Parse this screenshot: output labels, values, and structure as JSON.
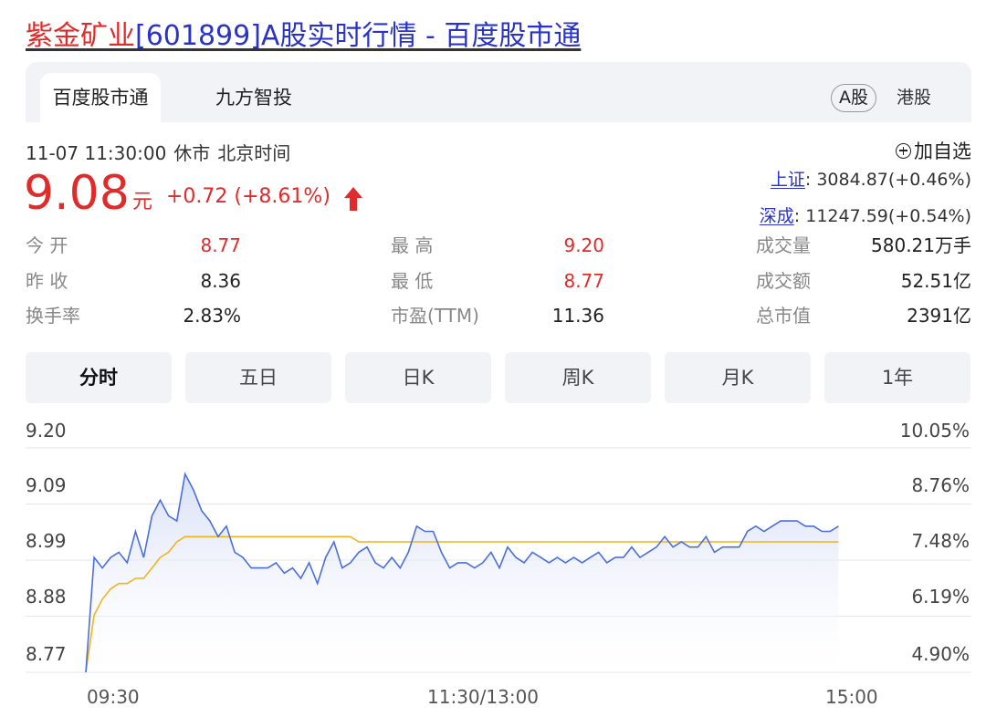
{
  "page": {
    "title_stock": "紫金矿业",
    "title_rest": "[601899]A股实时行情 - 百度股市通"
  },
  "tabs": {
    "active": "百度股市通",
    "second": "九方智投"
  },
  "markets": {
    "a_share": "A股",
    "hk_share": "港股"
  },
  "status": {
    "datetime": "11-07 11:30:00",
    "state": "休市",
    "timezone": "北京时间"
  },
  "add_watchlist": "加自选",
  "indices": [
    {
      "name": "上证",
      "value": ": 3084.87(+0.46%)"
    },
    {
      "name": "深成",
      "value": ": 11247.59(+0.54%)"
    }
  ],
  "price": {
    "value": "9.08",
    "unit": "元",
    "change": "+0.72 (+8.61%)",
    "color": "#e02b2b"
  },
  "quote": {
    "open_label": "今 开",
    "open": "8.77",
    "prev_close_label": "昨 收",
    "prev_close": "8.36",
    "turnover_rate_label": "换手率",
    "turnover_rate": "2.83%",
    "high_label": "最 高",
    "high": "9.20",
    "low_label": "最 低",
    "low": "8.77",
    "pe_label": "市盈(TTM)",
    "pe": "11.36",
    "volume_label": "成交量",
    "volume": "580.21万手",
    "amount_label": "成交额",
    "amount": "52.51亿",
    "mcap_label": "总市值",
    "mcap": "2391亿"
  },
  "periods": [
    "分时",
    "五日",
    "日K",
    "周K",
    "月K",
    "1年"
  ],
  "chart_data": {
    "type": "line",
    "y_ticks": [
      "9.20",
      "9.09",
      "8.99",
      "8.88",
      "8.77"
    ],
    "y_right_ticks": [
      "10.05%",
      "8.76%",
      "7.48%",
      "6.19%",
      "4.90%"
    ],
    "x_ticks": [
      "09:30",
      "11:30/13:00",
      "15:00"
    ],
    "ylim": [
      8.77,
      9.2
    ],
    "grid": true,
    "colors": {
      "price": "#4a6fdc",
      "avg": "#f2b31d",
      "fill": "#dde3f8"
    },
    "series": [
      {
        "values": [
          8.77,
          8.99,
          8.97,
          8.99,
          9.0,
          8.98,
          9.04,
          8.99,
          9.07,
          9.1,
          9.07,
          9.06,
          9.15,
          9.12,
          9.08,
          9.06,
          9.03,
          9.05,
          9.0,
          8.99,
          8.97,
          8.97,
          8.97,
          8.98,
          8.96,
          8.97,
          8.95,
          8.98,
          8.94,
          8.99,
          9.02,
          8.97,
          8.98,
          9.0,
          9.01,
          8.98,
          8.97,
          8.99,
          8.97,
          9.0,
          9.05,
          9.04,
          9.04,
          9.0,
          8.97,
          8.98,
          8.98,
          8.97,
          8.98,
          9.0,
          8.97,
          9.01,
          8.99,
          8.98,
          9.0,
          8.99,
          8.98,
          8.99,
          8.98,
          8.99,
          8.98,
          8.99,
          9.0,
          8.98,
          8.99,
          8.99,
          9.01,
          8.99,
          9.0,
          9.01,
          9.03,
          9.01,
          9.02,
          9.01,
          9.01,
          9.03,
          9.0,
          9.01,
          9.01,
          9.01,
          9.04,
          9.05,
          9.04,
          9.05,
          9.06,
          9.06,
          9.06,
          9.05,
          9.05,
          9.04,
          9.04,
          9.05
        ]
      },
      {
        "values": [
          8.77,
          8.88,
          8.91,
          8.93,
          8.94,
          8.94,
          8.95,
          8.95,
          8.97,
          8.99,
          9.0,
          9.02,
          9.03,
          9.03,
          9.03,
          9.03,
          9.03,
          9.03,
          9.03,
          9.03,
          9.03,
          9.03,
          9.03,
          9.03,
          9.03,
          9.03,
          9.03,
          9.03,
          9.03,
          9.03,
          9.03,
          9.03,
          9.03,
          9.02,
          9.02,
          9.02,
          9.02,
          9.02,
          9.02,
          9.02,
          9.02,
          9.02,
          9.02,
          9.02,
          9.02,
          9.02,
          9.02,
          9.02,
          9.02,
          9.02,
          9.02,
          9.02,
          9.02,
          9.02,
          9.02,
          9.02,
          9.02,
          9.02,
          9.02,
          9.02,
          9.02,
          9.02,
          9.02,
          9.02,
          9.02,
          9.02,
          9.02,
          9.02,
          9.02,
          9.02,
          9.02,
          9.02,
          9.02,
          9.02,
          9.02,
          9.02,
          9.02,
          9.02,
          9.02,
          9.02,
          9.02,
          9.02,
          9.02,
          9.02,
          9.02,
          9.02,
          9.02,
          9.02,
          9.02,
          9.02,
          9.02,
          9.02
        ]
      }
    ]
  }
}
